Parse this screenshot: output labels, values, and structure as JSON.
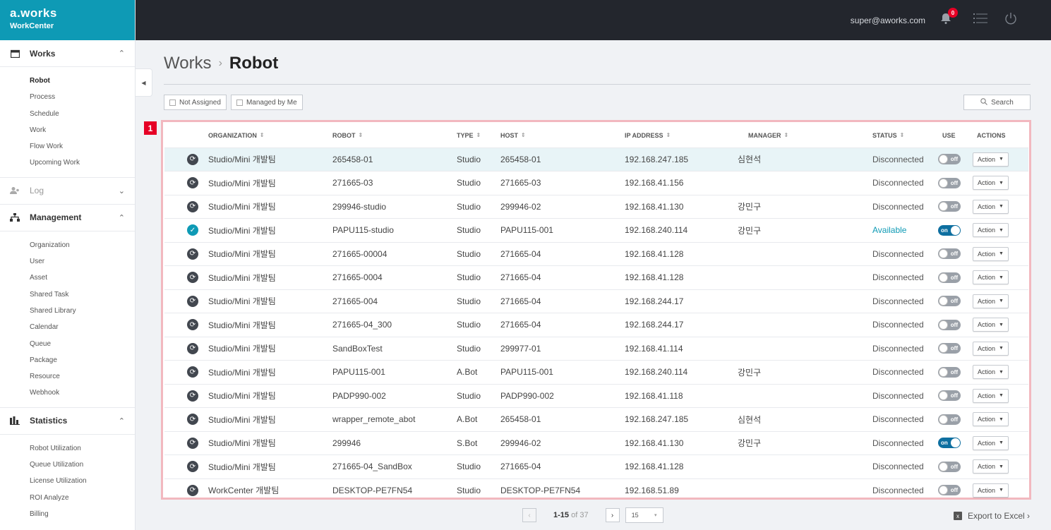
{
  "brand": {
    "logo": "a.works",
    "name": "WorkCenter"
  },
  "topbar": {
    "email": "super@aworks.com",
    "notification_count": "0"
  },
  "sidebar": {
    "works": {
      "title": "Works",
      "items": [
        "Robot",
        "Process",
        "Schedule",
        "Work",
        "Flow Work",
        "Upcoming Work"
      ]
    },
    "log": {
      "title": "Log"
    },
    "management": {
      "title": "Management",
      "items": [
        "Organization",
        "User",
        "Asset",
        "Shared Task",
        "Shared Library",
        "Calendar",
        "Queue",
        "Package",
        "Resource",
        "Webhook"
      ]
    },
    "statistics": {
      "title": "Statistics",
      "items": [
        "Robot Utilization",
        "Queue Utilization",
        "License Utilization",
        "ROI Analyze",
        "Billing"
      ]
    }
  },
  "breadcrumb": {
    "parent": "Works",
    "separator": "›",
    "current": "Robot"
  },
  "filters": {
    "not_assigned": "Not Assigned",
    "managed_by_me": "Managed by Me",
    "search": "Search"
  },
  "marker": "1",
  "table": {
    "headers": {
      "organization": "ORGANIZATION",
      "robot": "ROBOT",
      "type": "TYPE",
      "host": "HOST",
      "ip": "IP ADDRESS",
      "manager": "MANAGER",
      "status": "STATUS",
      "use": "USE",
      "actions": "ACTIONS"
    },
    "sort_glyph": "⇕",
    "action_label": "Action",
    "rows": [
      {
        "org": "Studio/Mini 개발팀",
        "robot": "265458-01",
        "type": "Studio",
        "host": "265458-01",
        "ip": "192.168.247.185",
        "manager": "심현석",
        "status": "Disconnected",
        "use": "off"
      },
      {
        "org": "Studio/Mini 개발팀",
        "robot": "271665-03",
        "type": "Studio",
        "host": "271665-03",
        "ip": "192.168.41.156",
        "manager": "",
        "status": "Disconnected",
        "use": "off"
      },
      {
        "org": "Studio/Mini 개발팀",
        "robot": "299946-studio",
        "type": "Studio",
        "host": "299946-02",
        "ip": "192.168.41.130",
        "manager": "강민구",
        "status": "Disconnected",
        "use": "off"
      },
      {
        "org": "Studio/Mini 개발팀",
        "robot": "PAPU115-studio",
        "type": "Studio",
        "host": "PAPU115-001",
        "ip": "192.168.240.114",
        "manager": "강민구",
        "status": "Available",
        "use": "on"
      },
      {
        "org": "Studio/Mini 개발팀",
        "robot": "271665-00004",
        "type": "Studio",
        "host": "271665-04",
        "ip": "192.168.41.128",
        "manager": "",
        "status": "Disconnected",
        "use": "off"
      },
      {
        "org": "Studio/Mini 개발팀",
        "robot": "271665-0004",
        "type": "Studio",
        "host": "271665-04",
        "ip": "192.168.41.128",
        "manager": "",
        "status": "Disconnected",
        "use": "off"
      },
      {
        "org": "Studio/Mini 개발팀",
        "robot": "271665-004",
        "type": "Studio",
        "host": "271665-04",
        "ip": "192.168.244.17",
        "manager": "",
        "status": "Disconnected",
        "use": "off"
      },
      {
        "org": "Studio/Mini 개발팀",
        "robot": "271665-04_300",
        "type": "Studio",
        "host": "271665-04",
        "ip": "192.168.244.17",
        "manager": "",
        "status": "Disconnected",
        "use": "off"
      },
      {
        "org": "Studio/Mini 개발팀",
        "robot": "SandBoxTest",
        "type": "Studio",
        "host": "299977-01",
        "ip": "192.168.41.114",
        "manager": "",
        "status": "Disconnected",
        "use": "off"
      },
      {
        "org": "Studio/Mini 개발팀",
        "robot": "PAPU115-001",
        "type": "A.Bot",
        "host": "PAPU115-001",
        "ip": "192.168.240.114",
        "manager": "강민구",
        "status": "Disconnected",
        "use": "off"
      },
      {
        "org": "Studio/Mini 개발팀",
        "robot": "PADP990-002",
        "type": "Studio",
        "host": "PADP990-002",
        "ip": "192.168.41.118",
        "manager": "",
        "status": "Disconnected",
        "use": "off"
      },
      {
        "org": "Studio/Mini 개발팀",
        "robot": "wrapper_remote_abot",
        "type": "A.Bot",
        "host": "265458-01",
        "ip": "192.168.247.185",
        "manager": "심현석",
        "status": "Disconnected",
        "use": "off"
      },
      {
        "org": "Studio/Mini 개발팀",
        "robot": "299946",
        "type": "S.Bot",
        "host": "299946-02",
        "ip": "192.168.41.130",
        "manager": "강민구",
        "status": "Disconnected",
        "use": "on"
      },
      {
        "org": "Studio/Mini 개발팀",
        "robot": "271665-04_SandBox",
        "type": "Studio",
        "host": "271665-04",
        "ip": "192.168.41.128",
        "manager": "",
        "status": "Disconnected",
        "use": "off"
      },
      {
        "org": "WorkCenter 개발팀",
        "robot": "DESKTOP-PE7FN54",
        "type": "Studio",
        "host": "DESKTOP-PE7FN54",
        "ip": "192.168.51.89",
        "manager": "",
        "status": "Disconnected",
        "use": "off"
      }
    ]
  },
  "pagination": {
    "range": "1-15",
    "of_label": "of 37",
    "page_size": "15"
  },
  "export": {
    "label": "Export to Excel ›"
  }
}
